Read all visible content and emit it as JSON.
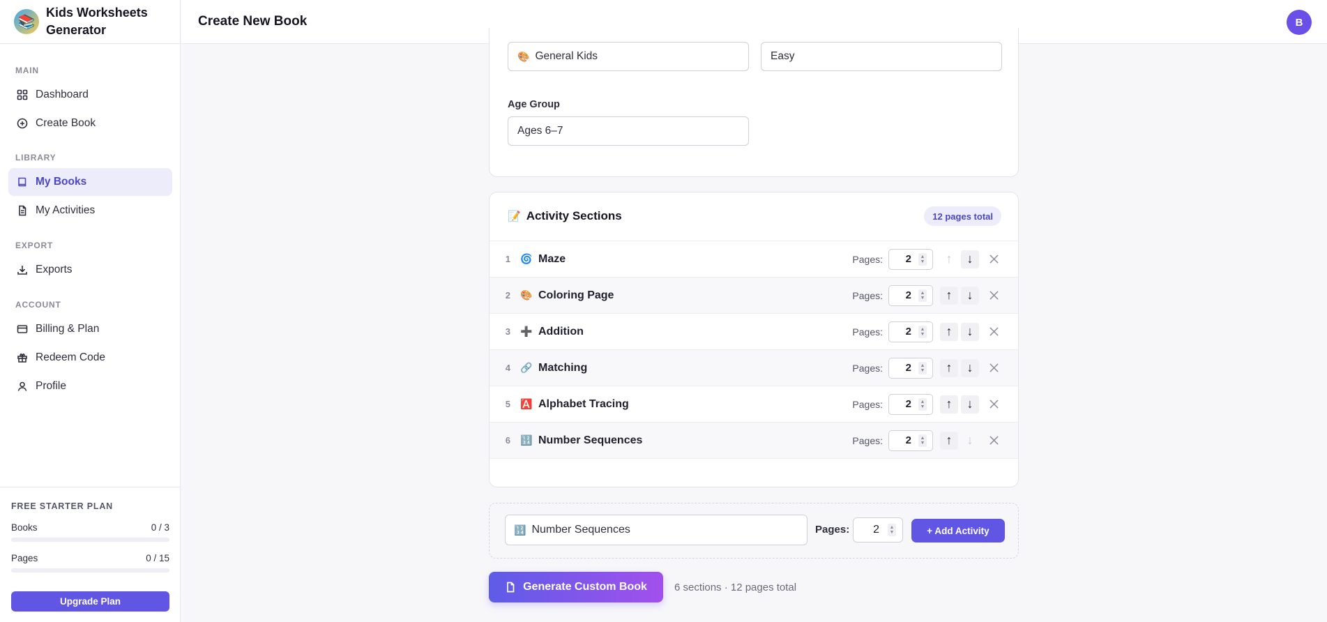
{
  "brand": {
    "title": "Kids Worksheets Generator",
    "logo_icon": "📚"
  },
  "sidebar": {
    "sections": [
      {
        "label": "MAIN"
      },
      {
        "label": "LIBRARY"
      },
      {
        "label": "EXPORT"
      },
      {
        "label": "ACCOUNT"
      }
    ],
    "items": [
      {
        "label": "Dashboard",
        "icon": "grid-icon"
      },
      {
        "label": "Create Book",
        "icon": "plus-circle-icon"
      },
      {
        "label": "My Books",
        "icon": "book-icon",
        "active": true
      },
      {
        "label": "My Activities",
        "icon": "document-icon"
      },
      {
        "label": "Exports",
        "icon": "download-icon"
      },
      {
        "label": "Billing & Plan",
        "icon": "credit-card-icon"
      },
      {
        "label": "Redeem Code",
        "icon": "gift-icon"
      },
      {
        "label": "Profile",
        "icon": "user-icon"
      }
    ],
    "plan": {
      "title": "FREE STARTER PLAN",
      "books_label": "Books",
      "books_value": "0 / 3",
      "books_fraction": 0,
      "pages_label": "Pages",
      "pages_value": "0 / 15",
      "pages_fraction": 0,
      "upgrade_label": "Upgrade Plan"
    }
  },
  "header": {
    "title": "Create New Book",
    "avatar_initial": "B"
  },
  "settings": {
    "theme_emoji": "🎨",
    "theme_value": "General Kids",
    "difficulty_value": "Easy",
    "age_label": "Age Group",
    "age_value": "Ages 6–7"
  },
  "activity_sections": {
    "title_emoji": "📝",
    "title": "Activity Sections",
    "badge": "12 pages total",
    "pages_label": "Pages:",
    "rows": [
      {
        "num": "1",
        "emoji": "🌀",
        "name": "Maze",
        "pages": "2"
      },
      {
        "num": "2",
        "emoji": "🎨",
        "name": "Coloring Page",
        "pages": "2"
      },
      {
        "num": "3",
        "emoji": "➕",
        "name": "Addition",
        "pages": "2"
      },
      {
        "num": "4",
        "emoji": "🔗",
        "name": "Matching",
        "pages": "2"
      },
      {
        "num": "5",
        "emoji": "🅰️",
        "name": "Alphabet Tracing",
        "pages": "2"
      },
      {
        "num": "6",
        "emoji": "🔢",
        "name": "Number Sequences",
        "pages": "2"
      }
    ]
  },
  "add_activity": {
    "select_emoji": "🔢",
    "select_value": "Number Sequences",
    "pages_label": "Pages:",
    "pages_value": "2",
    "button_label": "+ Add Activity"
  },
  "generate": {
    "button_label": "Generate Custom Book",
    "summary": "6 sections · 12 pages total"
  }
}
